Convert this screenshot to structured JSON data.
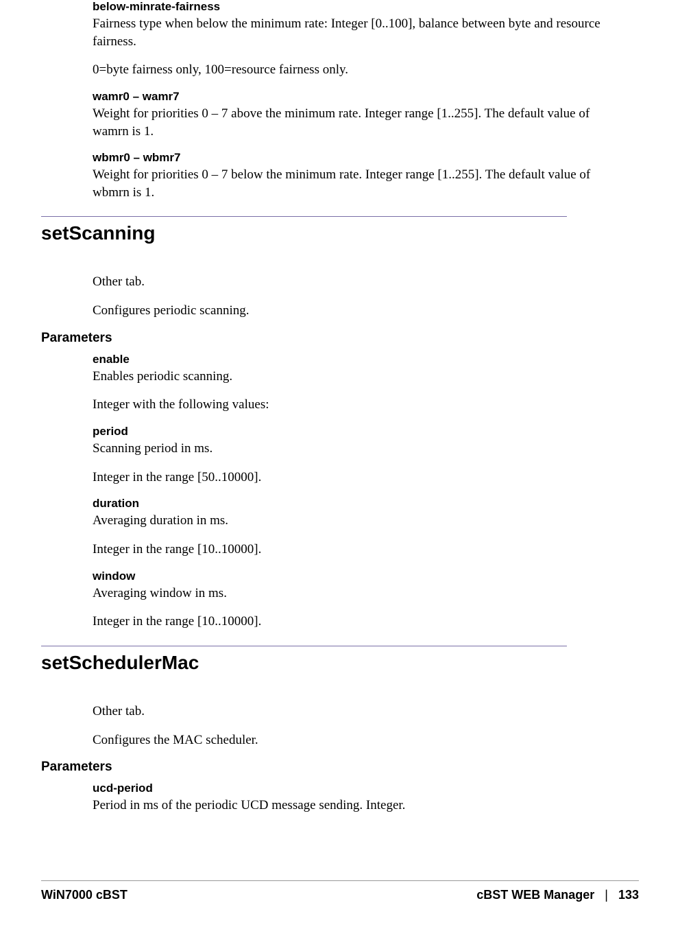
{
  "top": {
    "bmf_name": "below-minrate-fairness",
    "bmf_desc": "Fairness type when below the minimum rate: Integer [0..100], balance between byte and resource fairness.",
    "bmf_note": "0=byte fairness only, 100=resource fairness only.",
    "wamr_name": "wamr0 – wamr7",
    "wamr_desc": "Weight for priorities 0 – 7 above the minimum rate. Integer range [1..255]. The default value of wamrn is 1.",
    "wbmr_name": "wbmr0 – wbmr7",
    "wbmr_desc": "Weight for priorities 0 – 7 below the minimum rate. Integer range [1..255]. The default value of wbmrn is 1."
  },
  "setScanning": {
    "title": "setScanning",
    "tab": "Other tab.",
    "desc": "Configures periodic scanning.",
    "params_label": "Parameters",
    "enable_name": "enable",
    "enable_desc": "Enables periodic scanning.",
    "enable_note": "Integer with the following values:",
    "period_name": "period",
    "period_desc": "Scanning period in ms.",
    "period_note": "Integer in the range [50..10000].",
    "duration_name": "duration",
    "duration_desc": "Averaging duration in ms.",
    "duration_note": "Integer in the range [10..10000].",
    "window_name": "window",
    "window_desc": "Averaging window in ms.",
    "window_note": "Integer in the range [10..10000]."
  },
  "setSchedulerMac": {
    "title": "setSchedulerMac",
    "tab": "Other tab.",
    "desc": "Configures the MAC scheduler.",
    "params_label": "Parameters",
    "ucd_name": "ucd-period",
    "ucd_desc": "Period in ms of the periodic UCD message sending. Integer."
  },
  "footer": {
    "left": "WiN7000 cBST",
    "right_label": "cBST WEB Manager",
    "sep": "|",
    "page": "133"
  }
}
